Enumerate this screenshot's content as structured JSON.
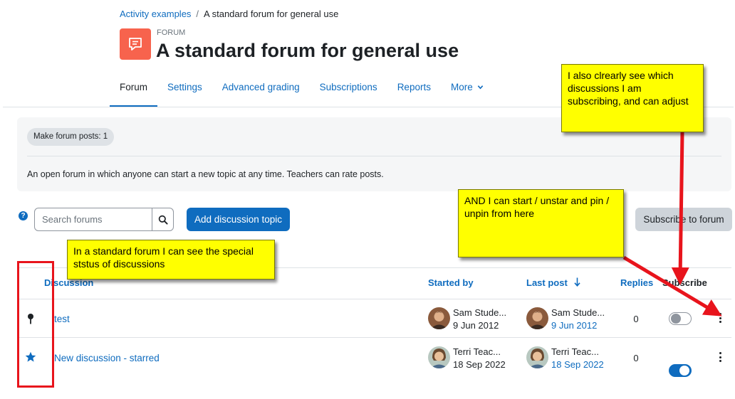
{
  "breadcrumb": {
    "parent": "Activity examples",
    "separator": "/",
    "current": "A standard forum for general use"
  },
  "header": {
    "kind": "FORUM",
    "title": "A standard forum for general use",
    "icon": "forum-chat-icon",
    "icon_color": "#f7634d"
  },
  "nav": {
    "tabs": [
      {
        "label": "Forum"
      },
      {
        "label": "Settings"
      },
      {
        "label": "Advanced grading"
      },
      {
        "label": "Subscriptions"
      },
      {
        "label": "Reports"
      },
      {
        "label": "More"
      }
    ],
    "active": "Forum"
  },
  "info": {
    "badge": "Make forum posts: 1",
    "description": "An open forum in which anyone can start a new topic at any time. Teachers can rate posts."
  },
  "toolbar": {
    "help_icon": "?",
    "search_placeholder": "Search forums",
    "add_label": "Add discussion topic",
    "subscribe_label": "Subscribe to forum"
  },
  "table": {
    "headers": {
      "discussion": "Discussion",
      "started_by": "Started by",
      "last_post": "Last post",
      "replies": "Replies",
      "subscribe": "Subscribe"
    },
    "rows": [
      {
        "status_icon": "pin-icon",
        "title": "test",
        "started_name": "Sam Stude...",
        "started_date": "9 Jun 2012",
        "last_name": "Sam Stude...",
        "last_date": "9 Jun 2012",
        "replies": "0",
        "subscribed": false
      },
      {
        "status_icon": "star-icon",
        "title": "New discussion - starred",
        "started_name": "Terri Teac...",
        "started_date": "18 Sep 2022",
        "last_name": "Terri Teac...",
        "last_date": "18 Sep 2022",
        "replies": "0",
        "subscribed": true
      }
    ]
  },
  "annotations": {
    "subscribing": "I also clrearly see which discussions I am subscribing, and can adjust",
    "star_pin": "AND I can start / unstar and pin / unpin from here",
    "status": "In a standard forum I can see the special ststus of discussions",
    "note_color": "#ffff00",
    "arrow_color": "#e8141c"
  },
  "colors": {
    "primary": "#0f6cbf",
    "text": "#1d2125",
    "muted": "#6a737b"
  }
}
